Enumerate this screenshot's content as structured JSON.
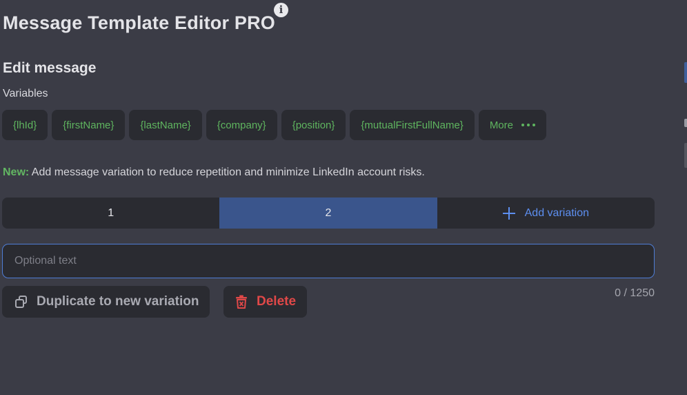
{
  "header": {
    "title": "Message Template Editor PRO",
    "info_icon": "info-icon"
  },
  "editor": {
    "section_title": "Edit message",
    "variables_label": "Variables",
    "variables": [
      "{lhId}",
      "{firstName}",
      "{lastName}",
      "{company}",
      "{position}",
      "{mutualFirstFullName}"
    ],
    "more_label": "More",
    "notice_prefix": "New:",
    "notice_text": " Add message variation to reduce repetition and minimize LinkedIn account risks.",
    "tabs": [
      "1",
      "2"
    ],
    "active_tab": "2",
    "add_variation_label": "Add variation",
    "textarea_placeholder": "Optional text",
    "textarea_value": "",
    "char_counter": "0 / 1250",
    "duplicate_label": "Duplicate to new variation",
    "delete_label": "Delete",
    "colors": {
      "variable_green": "#5fb55f",
      "active_tab_blue": "#3a558c",
      "link_blue": "#5d8ff0",
      "delete_red": "#e04848",
      "background": "#3b3c46",
      "surface": "#2a2b31"
    }
  }
}
